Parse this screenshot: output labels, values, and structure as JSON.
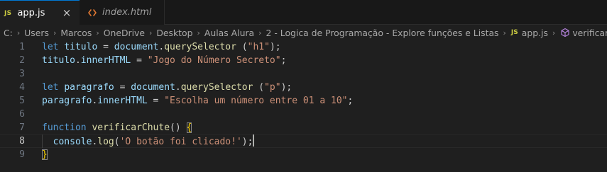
{
  "tabs": [
    {
      "label": "app.js",
      "badge": "JS",
      "active": true,
      "close": "×"
    },
    {
      "label": "index.html",
      "active": false
    }
  ],
  "breadcrumb": {
    "items": [
      "C:",
      "Users",
      "Marcos",
      "OneDrive",
      "Desktop",
      "Aulas Alura",
      "2 - Logica de Programação - Explore funções e Listas"
    ],
    "file_badge": "JS",
    "file": "app.js",
    "symbol": "verificarChute"
  },
  "editor": {
    "current_line": 8,
    "lines": [
      {
        "n": "1",
        "tokens": [
          {
            "t": "let ",
            "c": "k"
          },
          {
            "t": "titulo",
            "c": "v"
          },
          {
            "t": " = ",
            "c": "p"
          },
          {
            "t": "document",
            "c": "v"
          },
          {
            "t": ".",
            "c": "p"
          },
          {
            "t": "querySelector",
            "c": "f"
          },
          {
            "t": " (",
            "c": "p"
          },
          {
            "t": "\"h1\"",
            "c": "s"
          },
          {
            "t": ");",
            "c": "p"
          }
        ]
      },
      {
        "n": "2",
        "tokens": [
          {
            "t": "titulo",
            "c": "v"
          },
          {
            "t": ".",
            "c": "p"
          },
          {
            "t": "innerHTML",
            "c": "v"
          },
          {
            "t": " = ",
            "c": "p"
          },
          {
            "t": "\"Jogo do Número Secreto\"",
            "c": "s"
          },
          {
            "t": ";",
            "c": "p"
          }
        ]
      },
      {
        "n": "3",
        "tokens": []
      },
      {
        "n": "4",
        "tokens": [
          {
            "t": "let ",
            "c": "k"
          },
          {
            "t": "paragrafo",
            "c": "v"
          },
          {
            "t": " = ",
            "c": "p"
          },
          {
            "t": "document",
            "c": "v"
          },
          {
            "t": ".",
            "c": "p"
          },
          {
            "t": "querySelector",
            "c": "f"
          },
          {
            "t": " (",
            "c": "p"
          },
          {
            "t": "\"p\"",
            "c": "s"
          },
          {
            "t": ");",
            "c": "p"
          }
        ]
      },
      {
        "n": "5",
        "tokens": [
          {
            "t": "paragrafo",
            "c": "v"
          },
          {
            "t": ".",
            "c": "p"
          },
          {
            "t": "innerHTML",
            "c": "v"
          },
          {
            "t": " = ",
            "c": "p"
          },
          {
            "t": "\"Escolha um número entre 01 a 10\"",
            "c": "s"
          },
          {
            "t": ";",
            "c": "p"
          }
        ]
      },
      {
        "n": "6",
        "tokens": []
      },
      {
        "n": "7",
        "tokens": [
          {
            "t": "function ",
            "c": "k"
          },
          {
            "t": "verificarChute",
            "c": "f"
          },
          {
            "t": "() ",
            "c": "p"
          },
          {
            "t": "{",
            "c": "bm"
          }
        ]
      },
      {
        "n": "8",
        "guide": true,
        "cursor": true,
        "tokens": [
          {
            "t": "  ",
            "c": "p"
          },
          {
            "t": "console",
            "c": "v"
          },
          {
            "t": ".",
            "c": "p"
          },
          {
            "t": "log",
            "c": "f"
          },
          {
            "t": "(",
            "c": "p"
          },
          {
            "t": "'O botão foi clicado!'",
            "c": "s"
          },
          {
            "t": ");",
            "c": "p"
          }
        ]
      },
      {
        "n": "9",
        "tokens": [
          {
            "t": "}",
            "c": "bm"
          }
        ]
      }
    ]
  },
  "colors": {
    "keyword": "#569cd6",
    "variable": "#9cdcfe",
    "function": "#dcdcaa",
    "string": "#ce9178",
    "bracket": "#ffd700",
    "accent": "#0078d4",
    "js_badge": "#cbcb41",
    "html_icon": "#e37933",
    "method_icon": "#b180d7"
  },
  "icons": {
    "close": "close-icon",
    "html": "html-file-icon",
    "js": "js-file-icon",
    "method": "method-symbol-icon",
    "chevron": "chevron-right-icon"
  }
}
